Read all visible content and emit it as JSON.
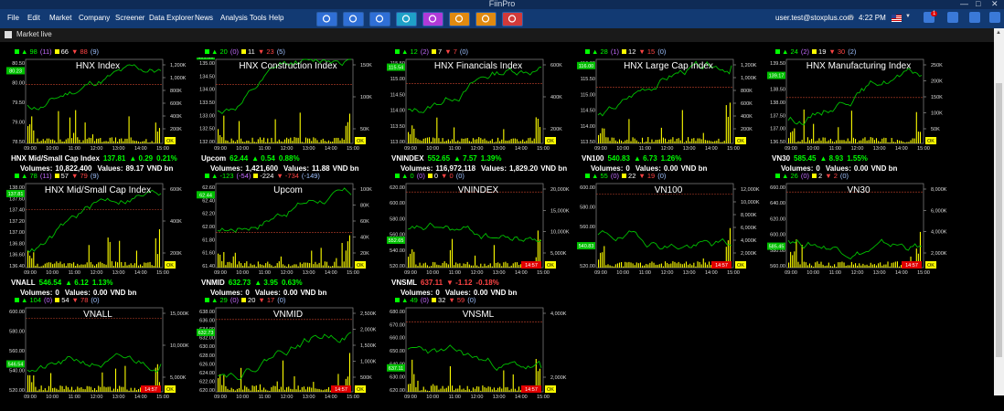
{
  "window": {
    "title": "FiinPro"
  },
  "menu": [
    "File",
    "Edit",
    "Market",
    "Company",
    "Screener",
    "Data Explorer",
    "News",
    "Analysis Tools",
    "Help"
  ],
  "toolbar_icons": [
    "globe-icon",
    "people-icon",
    "chart-icon",
    "camera-icon",
    "filter-icon",
    "team-icon",
    "report-icon",
    "ai-icon"
  ],
  "user": {
    "email": "user.test@stoxplus.com",
    "time": "4:22 PM",
    "notif": "1"
  },
  "panel": {
    "title": "Market live"
  },
  "colors": {
    "up": "#00ff00",
    "down": "#ff4444",
    "price_line": "#00c000",
    "volume": "#ffff00"
  },
  "charts": [
    {
      "title": "HNX Index",
      "counts": {
        "up": "98",
        "up_ceil": "(11)",
        "unchanged": "66",
        "down": "88",
        "down_floor": "(9)"
      },
      "y_ticks": [
        "80.50",
        "80.00",
        "79.50",
        "79.00",
        "78.50"
      ],
      "y_range": [
        78.5,
        80.5
      ],
      "vol_ticks": [
        "1,200K",
        "1,000K",
        "800K",
        "600K",
        "400K",
        "200K"
      ],
      "vol_max": 1200,
      "last": "80.23",
      "last_value": 80.23,
      "ref_value": 79.9,
      "badge": "OK",
      "show_time_badge": false,
      "summary": {
        "name": "HNX Mid/Small Cap Index",
        "value": "137.81",
        "dir": "up",
        "chg": "0.29",
        "pct": "0.21%"
      },
      "volume": "10,822,400",
      "values": "89.17"
    },
    {
      "title": "HNX Construction Index",
      "counts": {
        "up": "20",
        "up_ceil": "(0)",
        "unchanged": "11",
        "down": "23",
        "down_floor": "(5)"
      },
      "y_ticks": [
        "135.00",
        "134.50",
        "134.00",
        "133.50",
        "133.00",
        "132.50",
        "132.00"
      ],
      "y_range": [
        132.0,
        135.0
      ],
      "vol_ticks": [
        "150K",
        "100K",
        "50K"
      ],
      "vol_max": 160,
      "last": "135.12",
      "last_value": 135.12,
      "ref_value": 134.1,
      "badge": "OK",
      "show_time_badge": false,
      "summary": {
        "name": "Upcom",
        "value": "62.44",
        "dir": "up",
        "chg": "0.54",
        "pct": "0.88%"
      },
      "volume": "1,421,600",
      "values": "11.88"
    },
    {
      "title": "HNX Financials Index",
      "counts": {
        "up": "12",
        "up_ceil": "(2)",
        "unchanged": "7",
        "down": "7",
        "down_floor": "(0)"
      },
      "y_ticks": [
        "115.50",
        "115.00",
        "114.50",
        "114.00",
        "113.50",
        "113.00"
      ],
      "y_range": [
        113.0,
        115.8
      ],
      "vol_ticks": [
        "600K",
        "400K",
        "200K"
      ],
      "vol_max": 620,
      "last": "115.54",
      "last_value": 115.54,
      "ref_value": 115.0,
      "badge": "OK",
      "show_time_badge": false,
      "summary": {
        "name": "VNINDEX",
        "value": "552.65",
        "dir": "up",
        "chg": "7.57",
        "pct": "1.39%"
      },
      "volume": "116,972,118",
      "values": "1,829.20"
    },
    {
      "title": "HNX Large Cap Index",
      "counts": {
        "up": "28",
        "up_ceil": "(1)",
        "unchanged": "12",
        "down": "15",
        "down_floor": "(0)"
      },
      "y_ticks": [
        "116.00",
        "115.50",
        "115.00",
        "114.50",
        "114.00",
        "113.50"
      ],
      "y_range": [
        113.5,
        116.2
      ],
      "vol_ticks": [
        "1,200K",
        "1,000K",
        "800K",
        "600K",
        "400K",
        "200K"
      ],
      "vol_max": 1200,
      "last": "116.00",
      "last_value": 116.0,
      "ref_value": 115.3,
      "badge": "OK",
      "show_time_badge": false,
      "summary": {
        "name": "VN100",
        "value": "540.83",
        "dir": "up",
        "chg": "6.73",
        "pct": "1.26%"
      },
      "volume": "0",
      "values": "0.00"
    },
    {
      "title": "HNX Manufacturing Index",
      "counts": {
        "up": "24",
        "up_ceil": "(2)",
        "unchanged": "19",
        "down": "30",
        "down_floor": "(2)"
      },
      "y_ticks": [
        "139.50",
        "139.00",
        "138.50",
        "138.00",
        "137.50",
        "137.00",
        "136.50"
      ],
      "y_range": [
        136.5,
        139.8
      ],
      "vol_ticks": [
        "250K",
        "200K",
        "150K",
        "100K",
        "50K"
      ],
      "vol_max": 260,
      "last": "139.17",
      "last_value": 139.17,
      "ref_value": 138.3,
      "badge": "OK",
      "show_time_badge": false,
      "summary": {
        "name": "VN30",
        "value": "585.45",
        "dir": "up",
        "chg": "8.93",
        "pct": "1.55%"
      },
      "volume": "0",
      "values": "0.00"
    },
    {
      "title": "HNX Mid/Small Cap Index",
      "counts": {
        "up": "78",
        "up_ceil": "(11)",
        "unchanged": "57",
        "down": "79",
        "down_floor": "(9)"
      },
      "y_ticks": [
        "138.00",
        "137.60",
        "137.40",
        "137.20",
        "137.00",
        "136.80",
        "136.60",
        "136.40"
      ],
      "y_range": [
        136.4,
        138.0
      ],
      "vol_ticks": [
        "600K",
        "400K",
        "200K"
      ],
      "vol_max": 620,
      "last": "137.81",
      "last_value": 137.81,
      "ref_value": 137.5,
      "badge": "OK",
      "show_time_badge": false,
      "summary": {
        "name": "VNALL",
        "value": "546.54",
        "dir": "up",
        "chg": "6.12",
        "pct": "1.13%"
      },
      "volume": "0",
      "values": "0.00"
    },
    {
      "title": "Upcom",
      "counts": {
        "up": "-123",
        "up_ceil": "(-54)",
        "unchanged": "-224",
        "down": "-734",
        "down_floor": "(-149)"
      },
      "y_ticks": [
        "62.60",
        "62.40",
        "62.20",
        "62.00",
        "61.80",
        "61.60",
        "61.40"
      ],
      "y_range": [
        61.4,
        62.6
      ],
      "vol_ticks": [
        "100K",
        "80K",
        "60K",
        "40K",
        "20K"
      ],
      "vol_max": 105,
      "last": "62.44",
      "last_value": 62.44,
      "ref_value": 61.9,
      "badge": "OK",
      "show_time_badge": false,
      "summary": {
        "name": "VNMID",
        "value": "632.73",
        "dir": "up",
        "chg": "3.95",
        "pct": "0.63%"
      },
      "volume": "0",
      "values": "0.00"
    },
    {
      "title": "VNINDEX",
      "counts": {
        "up": "0",
        "up_ceil": "(0)",
        "unchanged": "0",
        "down": "0",
        "down_floor": "(0)"
      },
      "y_ticks": [
        "620.00",
        "600.00",
        "580.00",
        "560.00",
        "540.00",
        "520.00"
      ],
      "y_range": [
        520,
        620
      ],
      "vol_ticks": [
        "20,000K",
        "15,000K",
        "10,000K",
        "5,000K"
      ],
      "vol_max": 22000,
      "last": "552.65",
      "last_value": 552.65,
      "ref_value": 610,
      "badge": "OK",
      "show_time_badge": true,
      "time_badge": "14:57",
      "summary": {
        "name": "VNSML",
        "value": "637.11",
        "dir": "down",
        "chg": "-1.12",
        "pct": "-0.18%"
      },
      "volume": "0",
      "values": "0.00"
    },
    {
      "title": "VN100",
      "counts": {
        "up": "55",
        "up_ceil": "(0)",
        "unchanged": "22",
        "down": "19",
        "down_floor": "(0)"
      },
      "y_ticks": [
        "600.00",
        "580.00",
        "560.00",
        "540.00",
        "520.00"
      ],
      "y_range": [
        520,
        600
      ],
      "vol_ticks": [
        "12,000K",
        "10,000K",
        "8,000K",
        "6,000K",
        "4,000K",
        "2,000K"
      ],
      "vol_max": 12000,
      "last": "540.83",
      "last_value": 540.83,
      "ref_value": 590,
      "badge": "OK",
      "show_time_badge": true,
      "time_badge": "14:57",
      "summary": null
    },
    {
      "title": "VN30",
      "counts": {
        "up": "26",
        "up_ceil": "(0)",
        "unchanged": "2",
        "down": "2",
        "down_floor": "(0)"
      },
      "y_ticks": [
        "660.00",
        "640.00",
        "620.00",
        "600.00",
        "580.00",
        "560.00"
      ],
      "y_range": [
        560,
        660
      ],
      "vol_ticks": [
        "8,000K",
        "6,000K",
        "4,000K",
        "2,000K"
      ],
      "vol_max": 8500,
      "last": "585.45",
      "last_value": 585.45,
      "ref_value": 650,
      "badge": "OK",
      "show_time_badge": true,
      "time_badge": "14:57",
      "summary": null
    },
    {
      "title": "VNALL",
      "counts": {
        "up": "104",
        "up_ceil": "(0)",
        "unchanged": "54",
        "down": "78",
        "down_floor": "(0)"
      },
      "y_ticks": [
        "600.00",
        "580.00",
        "560.00",
        "540.00",
        "520.00"
      ],
      "y_range": [
        520,
        600
      ],
      "vol_ticks": [
        "15,000K",
        "10,000K",
        "5,000K"
      ],
      "vol_max": 17000,
      "last": "546.54",
      "last_value": 546.54,
      "ref_value": 590,
      "badge": "OK",
      "show_time_badge": true,
      "time_badge": "14:57",
      "summary": null
    },
    {
      "title": "VNMID",
      "counts": {
        "up": "29",
        "up_ceil": "(0)",
        "unchanged": "20",
        "down": "17",
        "down_floor": "(0)"
      },
      "y_ticks": [
        "638.00",
        "636.00",
        "634.00",
        "632.00",
        "630.00",
        "628.00",
        "626.00",
        "624.00",
        "622.00",
        "620.00"
      ],
      "y_range": [
        620,
        638
      ],
      "vol_ticks": [
        "2,500K",
        "2,000K",
        "1,500K",
        "1,000K",
        "500K"
      ],
      "vol_max": 2600,
      "last": "632.73",
      "last_value": 632.73,
      "ref_value": 635.5,
      "badge": "OK",
      "show_time_badge": true,
      "time_badge": "14:57",
      "summary": null
    },
    {
      "title": "VNSML",
      "counts": {
        "up": "49",
        "up_ceil": "(0)",
        "unchanged": "32",
        "down": "59",
        "down_floor": "(0)"
      },
      "y_ticks": [
        "680.00",
        "670.00",
        "660.00",
        "650.00",
        "640.00",
        "630.00",
        "620.00"
      ],
      "y_range": [
        620,
        680
      ],
      "vol_ticks": [
        "4,000K",
        "2,000K"
      ],
      "vol_max": 4500,
      "last": "637.11",
      "last_value": 637.11,
      "ref_value": 670,
      "badge": "OK",
      "show_time_badge": true,
      "time_badge": "14:57",
      "summary": null
    }
  ],
  "x_ticks": [
    "09:00",
    "10:00",
    "11:00",
    "12:00",
    "13:00",
    "14:00",
    "15:00"
  ],
  "labels": {
    "volumes": "Volumes:",
    "values": "Values:",
    "unit": "VND bn"
  }
}
